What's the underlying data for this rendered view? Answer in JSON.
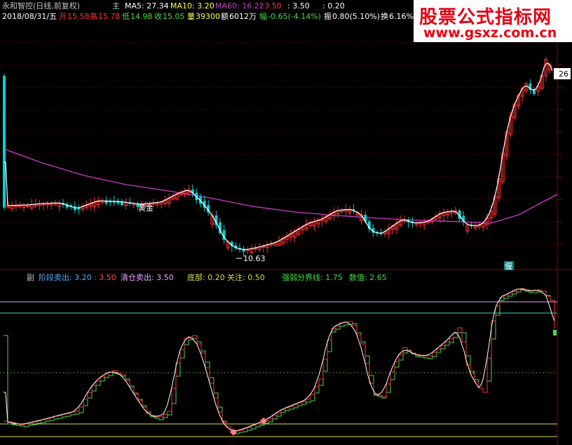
{
  "colors": {
    "up": "#ff3232",
    "down": "#00d2d2",
    "ma_main": "#ffffff",
    "ma60": "#c93cc9",
    "grid": "#8b0000",
    "white_line": "#ffffff",
    "green_line": "#44dd44",
    "red_line": "#ff3333",
    "lavender_level": "#e6a6ff",
    "cyan_level": "#44cccc",
    "yellow_level": "#dddd44",
    "gray_text": "#c0c0c0",
    "watermark_bg": "#ffffff",
    "watermark_red": "#e60012"
  },
  "header": {
    "stock": "永和智控(日线,前复权)",
    "mode": "主",
    "ma5": "MA5: 27.34",
    "ma10": "MA10: 3.20",
    "ma60": "MA60: 16.22",
    "v1": ": 3.50",
    "v2": ": 3.50",
    "v3": ": 0.20"
  },
  "info": {
    "date": "2018/08/31/五",
    "open_label": "开",
    "open_value": "15.58",
    "high_label": "高",
    "high_value": "15.78",
    "low_label": "低",
    "low_value": "14.98",
    "close_label": "收",
    "close_value": "15.05",
    "vol_label": "量",
    "vol_value": "39300",
    "amount_label": "额",
    "amount_value": "6012万",
    "chg_label": "幅",
    "chg_value": "-0.65(-4.14%)",
    "amp_label": "振",
    "amp_value": "0.80(5.10%)",
    "turn_label": "换",
    "turn_value": "6.16%"
  },
  "watermark": {
    "title": "股票公式指标网",
    "url": "www.gsxz.com.cn"
  },
  "labels": {
    "right_price": "26",
    "low_mark": "10.63",
    "golden": "黄金",
    "tag": "偃"
  },
  "sub": {
    "name": "副",
    "stage_sell": "阶段卖出: 3.20",
    "stage_sell2": ": 3.50",
    "clear_sell": "清仓卖出: 3.50",
    "bottom": "底部: 0.20",
    "watch": "关注: 0.50",
    "strong_weak": "强弱分界线: 1.75",
    "value": "数值: 2.65"
  },
  "chart_data": [
    {
      "type": "candlestick",
      "series": [
        {
          "name": "MA5"
        },
        {
          "name": "MA60"
        }
      ],
      "low_label_value": 10.63
    },
    {
      "type": "line",
      "series": [
        {
          "name": "阶段卖出",
          "values": [
            3.2,
            3.5
          ]
        },
        {
          "name": "清仓卖出",
          "values": [
            3.5
          ]
        },
        {
          "name": "底部",
          "values": [
            0.2
          ]
        },
        {
          "name": "关注",
          "values": [
            0.5
          ]
        },
        {
          "name": "强弱分界线",
          "values": [
            1.75
          ]
        },
        {
          "name": "数值",
          "values": [
            2.65
          ]
        }
      ]
    }
  ]
}
